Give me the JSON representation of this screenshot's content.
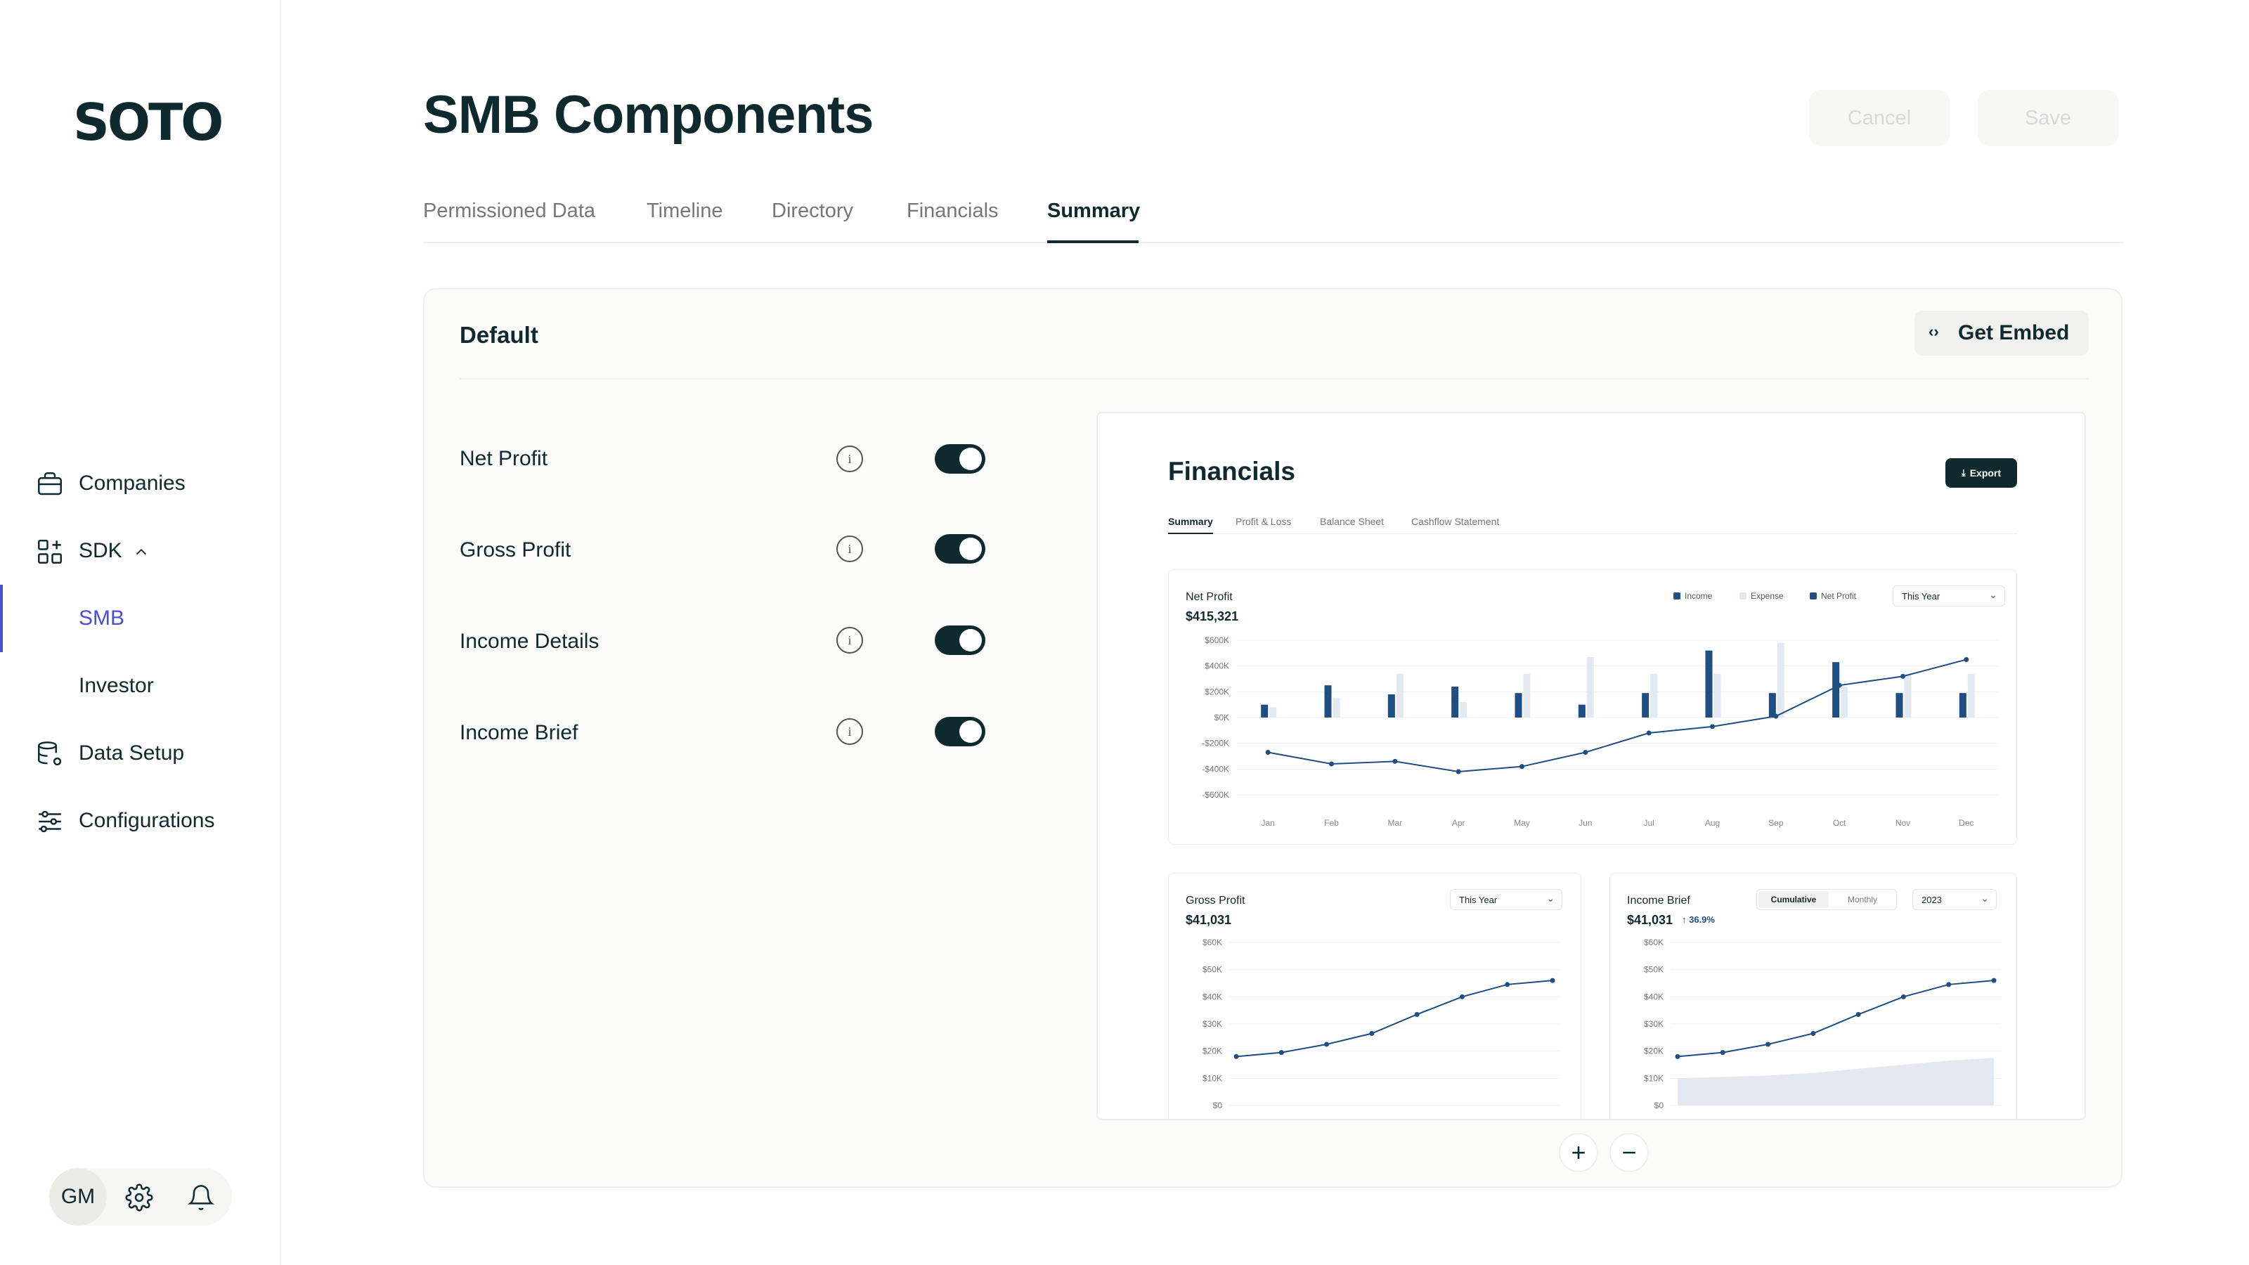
{
  "app": {
    "logo": "SOTO"
  },
  "sidebar": {
    "items": [
      {
        "label": "Companies",
        "icon": "briefcase-icon"
      },
      {
        "label": "SDK",
        "icon": "grid-plus-icon"
      },
      {
        "label": "SMB"
      },
      {
        "label": "Investor"
      },
      {
        "label": "Data Setup",
        "icon": "database-gear-icon"
      },
      {
        "label": "Configurations",
        "icon": "sliders-icon"
      }
    ],
    "user_initials": "GM"
  },
  "header": {
    "title": "SMB Components",
    "cancel_label": "Cancel",
    "save_label": "Save"
  },
  "tabs": [
    {
      "label": "Permissioned Data"
    },
    {
      "label": "Timeline"
    },
    {
      "label": "Directory"
    },
    {
      "label": "Financials"
    },
    {
      "label": "Summary",
      "active": true
    }
  ],
  "panel": {
    "title": "Default",
    "embed_label": "Get Embed",
    "rows": [
      {
        "label": "Net Profit",
        "enabled": true
      },
      {
        "label": "Gross Profit",
        "enabled": true
      },
      {
        "label": "Income Details",
        "enabled": true
      },
      {
        "label": "Income Brief",
        "enabled": true
      }
    ],
    "zoom_in": "+",
    "zoom_out": "−"
  },
  "preview": {
    "title": "Financials",
    "export_label": "Export",
    "tabs": [
      "Summary",
      "Profit & Loss",
      "Balance Sheet",
      "Cashflow Statement"
    ],
    "net_profit": {
      "label": "Net Profit",
      "value": "$415,321",
      "period": "This Year",
      "legend": [
        "Income",
        "Expense",
        "Net Profit"
      ]
    },
    "gross_profit": {
      "label": "Gross Profit",
      "value": "$41,031",
      "period": "This Year"
    },
    "income_brief": {
      "label": "Income Brief",
      "value": "$41,031",
      "change": "↑ 36.9%",
      "toggle": [
        "Cumulative",
        "Monthly"
      ],
      "year": "2023"
    }
  },
  "colors": {
    "primary": "#0f2a2e",
    "accent": "#4a4fd1",
    "income": "#1f4e82",
    "expense": "#e3e8f1"
  },
  "chart_data": [
    {
      "type": "bar",
      "title": "Net Profit",
      "categories": [
        "Jan",
        "Feb",
        "Mar",
        "Apr",
        "May",
        "Jun",
        "Jul",
        "Aug",
        "Sep",
        "Oct",
        "Nov",
        "Dec"
      ],
      "y_ticks": [
        "$600K",
        "$400K",
        "$200K",
        "$0K",
        "-$200K",
        "-$400K",
        "-$600K"
      ],
      "ylim": [
        -600,
        600
      ],
      "series": [
        {
          "name": "Income",
          "values": [
            100,
            250,
            180,
            240,
            190,
            100,
            190,
            520,
            190,
            430,
            190,
            190
          ]
        },
        {
          "name": "Expense",
          "values": [
            80,
            150,
            340,
            120,
            340,
            470,
            340,
            340,
            580,
            240,
            340,
            340
          ]
        },
        {
          "name": "Net Profit",
          "values": [
            -270,
            -360,
            -340,
            -420,
            -380,
            -270,
            -120,
            -70,
            10,
            250,
            320,
            450
          ]
        }
      ]
    },
    {
      "type": "line",
      "title": "Gross Profit",
      "y_ticks": [
        "$60K",
        "$50K",
        "$40K",
        "$30K",
        "$20K",
        "$10K",
        "$0"
      ],
      "ylim": [
        0,
        60
      ],
      "values": [
        18,
        19.5,
        22.5,
        26.5,
        33.5,
        40,
        44.5,
        46
      ]
    },
    {
      "type": "area",
      "title": "Income Brief",
      "y_ticks": [
        "$60K",
        "$50K",
        "$40K",
        "$30K",
        "$20K",
        "$10K",
        "$0"
      ],
      "ylim": [
        0,
        60
      ],
      "series": [
        {
          "values": [
            18,
            19.5,
            22.5,
            26.5,
            33.5,
            40,
            44.5,
            46
          ]
        },
        {
          "values": [
            10,
            10.5,
            11,
            12,
            13.5,
            15,
            16.5,
            17.5
          ]
        }
      ]
    }
  ]
}
